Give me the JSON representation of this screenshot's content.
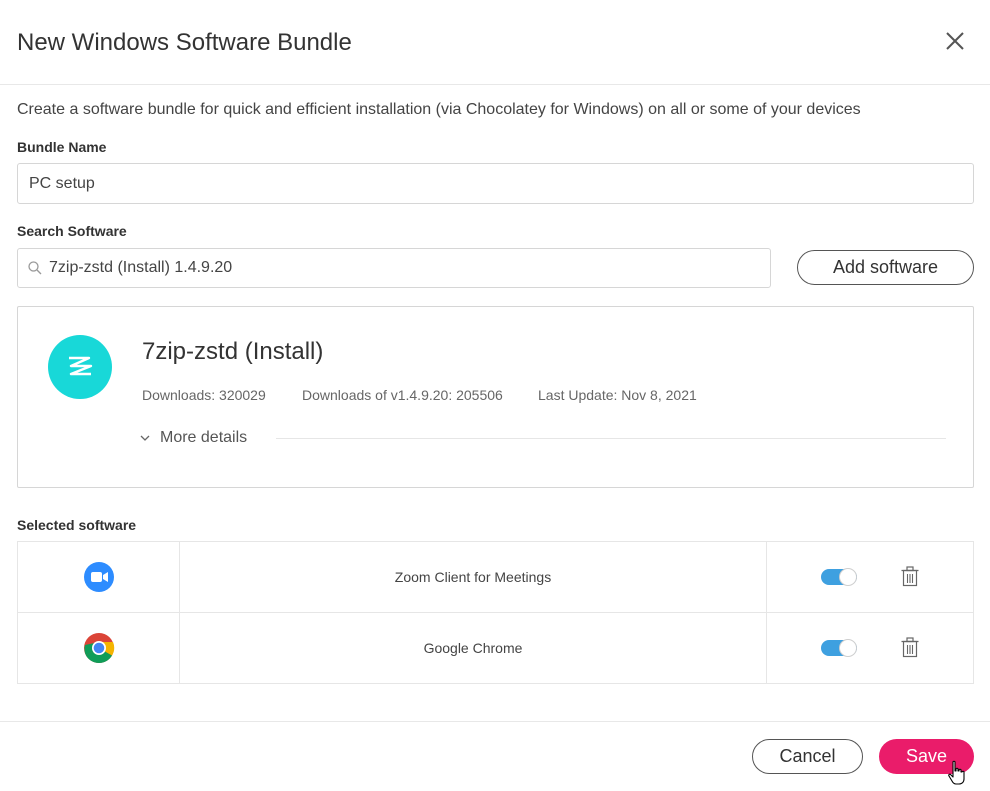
{
  "dialog": {
    "title": "New Windows Software Bundle",
    "description": "Create a software bundle for quick and efficient installation (via Chocolatey for Windows) on all or some of your devices"
  },
  "bundle_name": {
    "label": "Bundle Name",
    "value": "PC setup"
  },
  "search": {
    "label": "Search Software",
    "value": "7zip-zstd (Install) 1.4.9.20",
    "add_button": "Add software"
  },
  "package_card": {
    "name": "7zip-zstd (Install)",
    "downloads": "Downloads: 320029",
    "version_downloads": "Downloads of v1.4.9.20: 205506",
    "last_update": "Last Update: Nov 8, 2021",
    "more_details": "More details"
  },
  "selected": {
    "label": "Selected software",
    "items": [
      {
        "name": "Zoom Client for Meetings",
        "icon": "zoom-icon",
        "enabled": true
      },
      {
        "name": "Google Chrome",
        "icon": "chrome-icon",
        "enabled": true
      }
    ]
  },
  "footer": {
    "cancel": "Cancel",
    "save": "Save"
  },
  "colors": {
    "accent": "#ea1c6a",
    "toggle_on": "#3ea0e0",
    "package_logo": "#18d8d8"
  }
}
